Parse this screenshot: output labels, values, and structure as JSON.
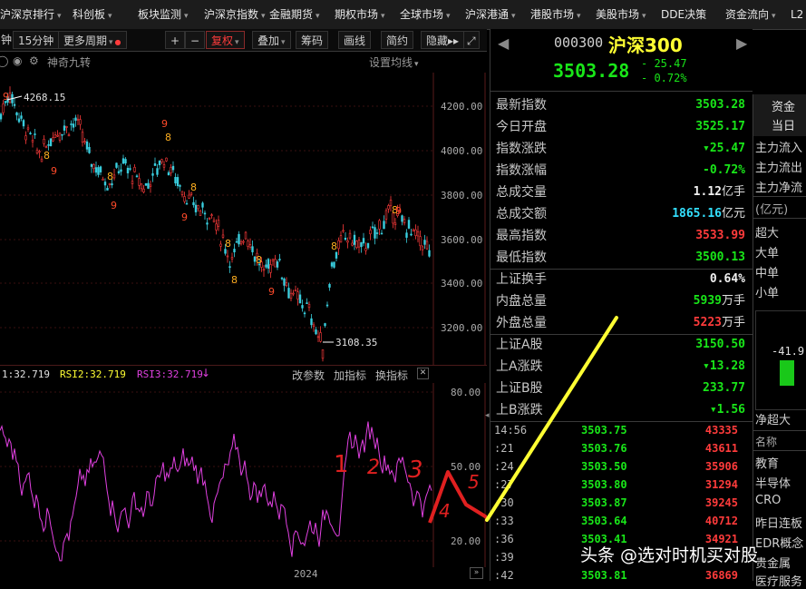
{
  "menu": {
    "items": [
      {
        "label": "沪深京排行",
        "caret": true
      },
      {
        "label": "科创板",
        "caret": true
      },
      {
        "label": "板块监测",
        "caret": true
      },
      {
        "label": "沪深京指数",
        "caret": true
      },
      {
        "label": "金融期货",
        "caret": true
      },
      {
        "label": "期权市场",
        "caret": true
      },
      {
        "label": "全球市场",
        "caret": true
      },
      {
        "label": "沪深港通",
        "caret": true
      },
      {
        "label": "港股市场",
        "caret": true
      },
      {
        "label": "美股市场",
        "caret": true
      },
      {
        "label": "DDE决策",
        "caret": false
      },
      {
        "label": "资金流向",
        "caret": true
      },
      {
        "label": "L2",
        "caret": false
      }
    ]
  },
  "toolbar": {
    "period_partial": "钟",
    "min15": "15分钟",
    "more_period": "更多周期",
    "plus": "+",
    "minus": "−",
    "fuquan": "复权",
    "overlay": "叠加",
    "chips": "筹码",
    "draw": "画线",
    "simple": "简约",
    "hide": "隐藏",
    "more": "▸▸",
    "expand": "⤢"
  },
  "chart": {
    "indicator_name": "神奇九转",
    "ma_setting": "设置均线",
    "high_label": "4268.15",
    "low_label": "3108.35",
    "y_ticks": [
      "4200.00",
      "4000.00",
      "3800.00",
      "3600.00",
      "3400.00",
      "3200.00"
    ],
    "x_label": "2024"
  },
  "rsi": {
    "rsi1": "1:32.719",
    "rsi2": "RSI2:32.719",
    "rsi3": "RSI3:32.719",
    "change_param": "改参数",
    "add_indicator": "加指标",
    "switch_indicator": "换指标",
    "y_ticks": [
      "80.00",
      "50.00",
      "20.00"
    ],
    "annotations": [
      "1",
      "2",
      "3",
      "4",
      "5"
    ]
  },
  "quote": {
    "code": "000300",
    "name": "沪深300",
    "price": "3503.28",
    "change": "- 25.47",
    "change_pct": "- 0.72%",
    "rows": [
      {
        "label": "最新指数",
        "value": "3503.28",
        "color": "green"
      },
      {
        "label": "今日开盘",
        "value": "3525.17",
        "color": "green"
      },
      {
        "label": "指数涨跌",
        "value": "▾25.47",
        "color": "green"
      },
      {
        "label": "指数涨幅",
        "value": "-0.72%",
        "color": "green"
      },
      {
        "label": "总成交量",
        "value": "1.12",
        "unit": "亿手",
        "color": "white"
      },
      {
        "label": "总成交额",
        "value": "1865.16",
        "unit": "亿元",
        "color": "cyan"
      },
      {
        "label": "最高指数",
        "value": "3533.99",
        "color": "red"
      },
      {
        "label": "最低指数",
        "value": "3500.13",
        "color": "green"
      },
      {
        "label": "上证换手",
        "value": "0.64%",
        "color": "white"
      },
      {
        "label": "内盘总量",
        "value": "5939",
        "unit": "万手",
        "color": "green"
      },
      {
        "label": "外盘总量",
        "value": "5223",
        "unit": "万手",
        "color": "red"
      },
      {
        "label": "上证A股",
        "value": "3150.50",
        "color": "green"
      },
      {
        "label": "上A涨跌",
        "value": "▾13.28",
        "color": "green"
      },
      {
        "label": "上证B股",
        "value": "233.77",
        "color": "green"
      },
      {
        "label": "上B涨跌",
        "value": "▾1.56",
        "color": "green"
      }
    ]
  },
  "ticks": [
    {
      "time": "14:56",
      "price": "3503.75",
      "vol": "43335"
    },
    {
      "time": ":21",
      "price": "3503.76",
      "vol": "43611"
    },
    {
      "time": ":24",
      "price": "3503.50",
      "vol": "35906"
    },
    {
      "time": ":27",
      "price": "3503.80",
      "vol": "31294"
    },
    {
      "time": ":30",
      "price": "3503.87",
      "vol": "39245"
    },
    {
      "time": ":33",
      "price": "3503.64",
      "vol": "40712"
    },
    {
      "time": ":36",
      "price": "3503.41",
      "vol": "34921"
    },
    {
      "time": ":39",
      "price": "",
      "vol": ""
    },
    {
      "time": ":42",
      "price": "3503.81",
      "vol": "36869"
    }
  ],
  "side": {
    "tab_capital": "资金",
    "tab_today": "当日",
    "inflow": "主力流入",
    "outflow": "主力流出",
    "net": "主力净流",
    "unit": "(亿元)",
    "sizes": [
      "超大",
      "大单",
      "中单",
      "小单"
    ],
    "bar_value": "-41.9",
    "net_super": "净超大",
    "list_header": "名称",
    "list": [
      "教育",
      "半导体",
      "CRO",
      "昨日连板",
      "EDR概念",
      "贵金属",
      "医疗服务"
    ]
  },
  "watermark": "头条 @选对时机买对股",
  "colors": {
    "up": "#ff3b3b",
    "down": "#19e619",
    "rsi": "#e040e0",
    "accent_yellow": "#ffff33"
  }
}
